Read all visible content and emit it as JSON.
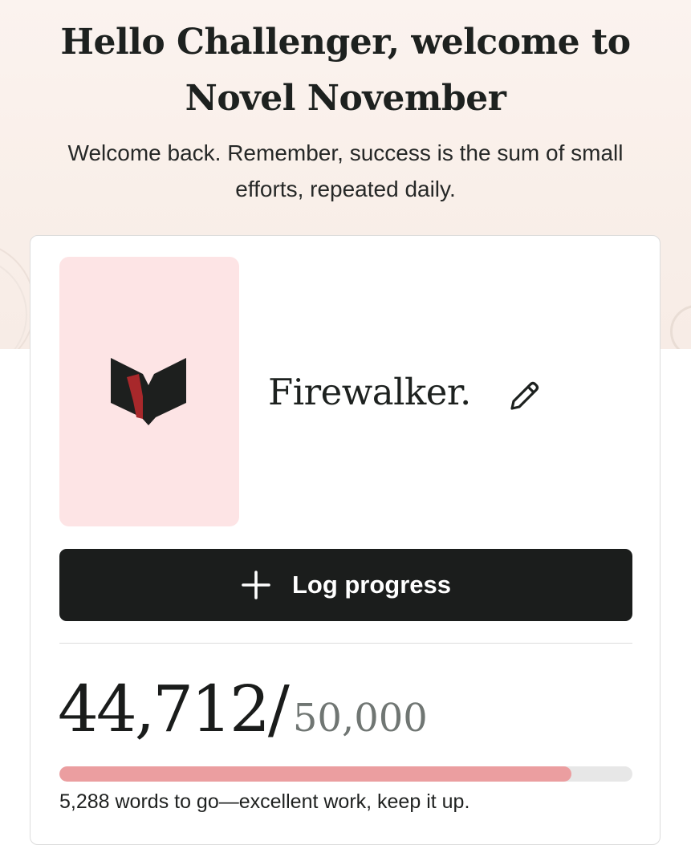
{
  "header": {
    "title": "Hello Challenger, welcome to Novel November",
    "subtitle": "Welcome back. Remember, success is the sum of small efforts, repeated daily."
  },
  "project": {
    "name": "Firewalker.",
    "cover_color": "#fde4e5",
    "cover_icon": "book-logo-icon",
    "edit_icon": "pencil-icon"
  },
  "actions": {
    "log_progress_label": "Log progress",
    "log_progress_icon": "plus-icon"
  },
  "progress": {
    "words_written": "44,712",
    "separator": "/",
    "word_goal": "50,000",
    "fraction_complete": 0.894,
    "fill_color": "#eb9ea0",
    "remaining_text": "5,288 words to go—excellent work, keep it up."
  },
  "colors": {
    "primary_button": "#1b1d1c",
    "accent": "#a8282b"
  }
}
